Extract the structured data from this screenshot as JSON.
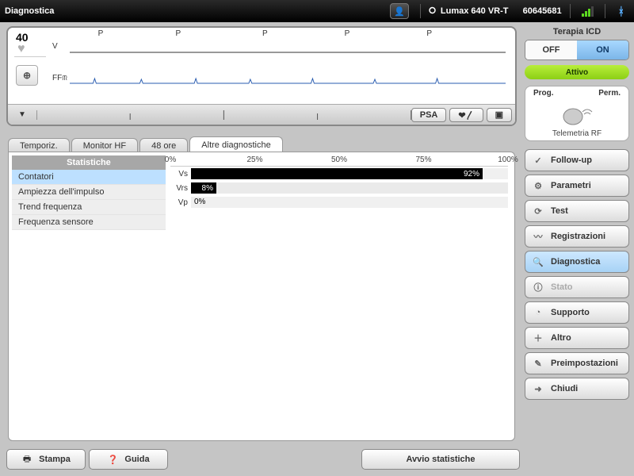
{
  "topbar": {
    "title": "Diagnostica",
    "device_model": "Lumax 640 VR-T",
    "device_serial": "60645681"
  },
  "ecg": {
    "rate": "40",
    "lead1": "V",
    "lead2": "FF",
    "markers": [
      "P",
      "P",
      "P",
      "P",
      "P"
    ],
    "marker_positions_pct": [
      10,
      27,
      46,
      64,
      82
    ],
    "psa_label": "PSA"
  },
  "tabs": [
    "Temporiz.",
    "Monitor HF",
    "48 ore",
    "Altre diagnostiche"
  ],
  "active_tab": 3,
  "side": {
    "header": "Statistiche",
    "items": [
      "Contatori",
      "Ampiezza dell'impulso",
      "Trend frequenza",
      "Frequenza sensore"
    ],
    "selected": 0
  },
  "chart_data": {
    "type": "bar",
    "orientation": "horizontal",
    "categories": [
      "Vs",
      "Vrs",
      "Vp"
    ],
    "values": [
      92,
      8,
      0
    ],
    "xlabel": "",
    "ylabel": "",
    "xlim": [
      0,
      100
    ],
    "ticks": [
      0,
      25,
      50,
      75,
      100
    ],
    "value_suffix": "%"
  },
  "actions": {
    "print": "Stampa",
    "help": "Guida",
    "start_stats": "Avvio statistiche"
  },
  "right": {
    "therapy_title": "Terapia ICD",
    "off": "OFF",
    "on": "ON",
    "status": "Attivo",
    "telemetry": {
      "prog": "Prog.",
      "perm": "Perm.",
      "label": "Telemetria RF"
    },
    "nav": [
      {
        "label": "Follow-up",
        "icon": "✓"
      },
      {
        "label": "Parametri",
        "icon": "⚙"
      },
      {
        "label": "Test",
        "icon": "⟳"
      },
      {
        "label": "Registrazioni",
        "icon": "〰"
      },
      {
        "label": "Diagnostica",
        "icon": "🔍",
        "selected": true
      },
      {
        "label": "Stato",
        "icon": "ⓘ",
        "dim": true
      },
      {
        "label": "Supporto",
        "icon": "◔"
      },
      {
        "label": "Altro",
        "icon": "＋"
      },
      {
        "label": "Preimpostazioni",
        "icon": "✎"
      },
      {
        "label": "Chiudi",
        "icon": "➜"
      }
    ]
  }
}
